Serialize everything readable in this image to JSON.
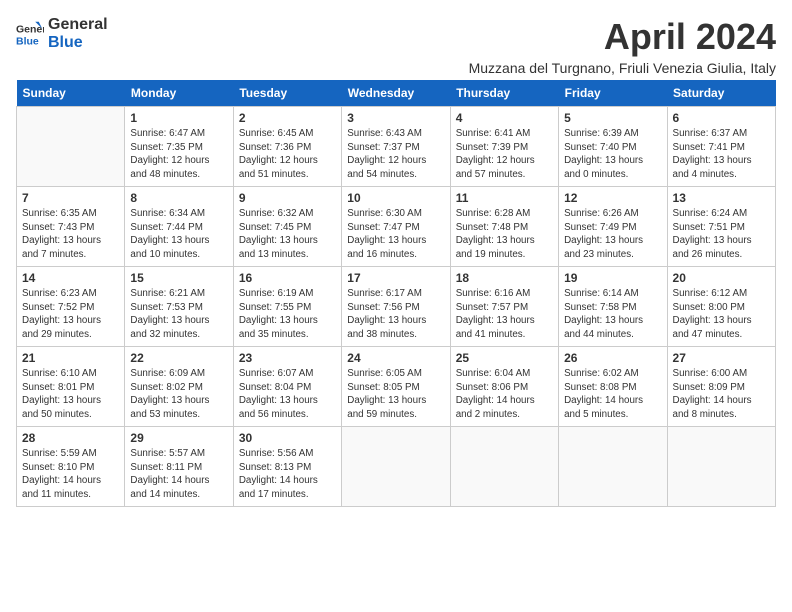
{
  "header": {
    "logo_general": "General",
    "logo_blue": "Blue",
    "month_title": "April 2024",
    "subtitle": "Muzzana del Turgnano, Friuli Venezia Giulia, Italy"
  },
  "days_of_week": [
    "Sunday",
    "Monday",
    "Tuesday",
    "Wednesday",
    "Thursday",
    "Friday",
    "Saturday"
  ],
  "weeks": [
    [
      {
        "day": "",
        "info": ""
      },
      {
        "day": "1",
        "info": "Sunrise: 6:47 AM\nSunset: 7:35 PM\nDaylight: 12 hours\nand 48 minutes."
      },
      {
        "day": "2",
        "info": "Sunrise: 6:45 AM\nSunset: 7:36 PM\nDaylight: 12 hours\nand 51 minutes."
      },
      {
        "day": "3",
        "info": "Sunrise: 6:43 AM\nSunset: 7:37 PM\nDaylight: 12 hours\nand 54 minutes."
      },
      {
        "day": "4",
        "info": "Sunrise: 6:41 AM\nSunset: 7:39 PM\nDaylight: 12 hours\nand 57 minutes."
      },
      {
        "day": "5",
        "info": "Sunrise: 6:39 AM\nSunset: 7:40 PM\nDaylight: 13 hours\nand 0 minutes."
      },
      {
        "day": "6",
        "info": "Sunrise: 6:37 AM\nSunset: 7:41 PM\nDaylight: 13 hours\nand 4 minutes."
      }
    ],
    [
      {
        "day": "7",
        "info": "Sunrise: 6:35 AM\nSunset: 7:43 PM\nDaylight: 13 hours\nand 7 minutes."
      },
      {
        "day": "8",
        "info": "Sunrise: 6:34 AM\nSunset: 7:44 PM\nDaylight: 13 hours\nand 10 minutes."
      },
      {
        "day": "9",
        "info": "Sunrise: 6:32 AM\nSunset: 7:45 PM\nDaylight: 13 hours\nand 13 minutes."
      },
      {
        "day": "10",
        "info": "Sunrise: 6:30 AM\nSunset: 7:47 PM\nDaylight: 13 hours\nand 16 minutes."
      },
      {
        "day": "11",
        "info": "Sunrise: 6:28 AM\nSunset: 7:48 PM\nDaylight: 13 hours\nand 19 minutes."
      },
      {
        "day": "12",
        "info": "Sunrise: 6:26 AM\nSunset: 7:49 PM\nDaylight: 13 hours\nand 23 minutes."
      },
      {
        "day": "13",
        "info": "Sunrise: 6:24 AM\nSunset: 7:51 PM\nDaylight: 13 hours\nand 26 minutes."
      }
    ],
    [
      {
        "day": "14",
        "info": "Sunrise: 6:23 AM\nSunset: 7:52 PM\nDaylight: 13 hours\nand 29 minutes."
      },
      {
        "day": "15",
        "info": "Sunrise: 6:21 AM\nSunset: 7:53 PM\nDaylight: 13 hours\nand 32 minutes."
      },
      {
        "day": "16",
        "info": "Sunrise: 6:19 AM\nSunset: 7:55 PM\nDaylight: 13 hours\nand 35 minutes."
      },
      {
        "day": "17",
        "info": "Sunrise: 6:17 AM\nSunset: 7:56 PM\nDaylight: 13 hours\nand 38 minutes."
      },
      {
        "day": "18",
        "info": "Sunrise: 6:16 AM\nSunset: 7:57 PM\nDaylight: 13 hours\nand 41 minutes."
      },
      {
        "day": "19",
        "info": "Sunrise: 6:14 AM\nSunset: 7:58 PM\nDaylight: 13 hours\nand 44 minutes."
      },
      {
        "day": "20",
        "info": "Sunrise: 6:12 AM\nSunset: 8:00 PM\nDaylight: 13 hours\nand 47 minutes."
      }
    ],
    [
      {
        "day": "21",
        "info": "Sunrise: 6:10 AM\nSunset: 8:01 PM\nDaylight: 13 hours\nand 50 minutes."
      },
      {
        "day": "22",
        "info": "Sunrise: 6:09 AM\nSunset: 8:02 PM\nDaylight: 13 hours\nand 53 minutes."
      },
      {
        "day": "23",
        "info": "Sunrise: 6:07 AM\nSunset: 8:04 PM\nDaylight: 13 hours\nand 56 minutes."
      },
      {
        "day": "24",
        "info": "Sunrise: 6:05 AM\nSunset: 8:05 PM\nDaylight: 13 hours\nand 59 minutes."
      },
      {
        "day": "25",
        "info": "Sunrise: 6:04 AM\nSunset: 8:06 PM\nDaylight: 14 hours\nand 2 minutes."
      },
      {
        "day": "26",
        "info": "Sunrise: 6:02 AM\nSunset: 8:08 PM\nDaylight: 14 hours\nand 5 minutes."
      },
      {
        "day": "27",
        "info": "Sunrise: 6:00 AM\nSunset: 8:09 PM\nDaylight: 14 hours\nand 8 minutes."
      }
    ],
    [
      {
        "day": "28",
        "info": "Sunrise: 5:59 AM\nSunset: 8:10 PM\nDaylight: 14 hours\nand 11 minutes."
      },
      {
        "day": "29",
        "info": "Sunrise: 5:57 AM\nSunset: 8:11 PM\nDaylight: 14 hours\nand 14 minutes."
      },
      {
        "day": "30",
        "info": "Sunrise: 5:56 AM\nSunset: 8:13 PM\nDaylight: 14 hours\nand 17 minutes."
      },
      {
        "day": "",
        "info": ""
      },
      {
        "day": "",
        "info": ""
      },
      {
        "day": "",
        "info": ""
      },
      {
        "day": "",
        "info": ""
      }
    ]
  ]
}
